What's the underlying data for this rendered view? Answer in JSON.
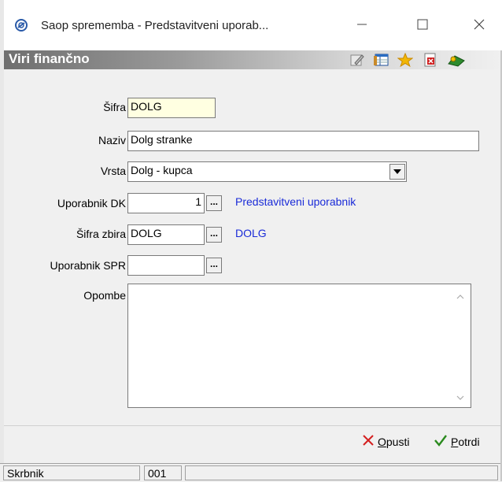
{
  "window": {
    "title": "Saop sprememba - Predstavitveni uporab..."
  },
  "header": {
    "title": "Viri finančno",
    "toolbar_icons": [
      "edit-icon",
      "table-icon",
      "star-icon",
      "delete-icon",
      "exit-icon"
    ]
  },
  "form": {
    "sifra": {
      "label": "Šifra",
      "value": "DOLG"
    },
    "naziv": {
      "label": "Naziv",
      "value": "Dolg stranke"
    },
    "vrsta": {
      "label": "Vrsta",
      "value": "Dolg - kupca"
    },
    "uporabnik_dk": {
      "label": "Uporabnik DK",
      "value": "1",
      "link": "Predstavitveni uporabnik",
      "dots": "..."
    },
    "sifra_zbira": {
      "label": "Šifra zbira",
      "value": "DOLG",
      "link": "DOLG",
      "dots": "..."
    },
    "uporabnik_spr": {
      "label": "Uporabnik SPR",
      "value": "",
      "dots": "..."
    },
    "opombe": {
      "label": "Opombe",
      "value": ""
    }
  },
  "actions": {
    "cancel": {
      "prefix": "",
      "accel": "O",
      "rest": "pusti"
    },
    "confirm": {
      "prefix": "",
      "accel": "P",
      "rest": "otrdi"
    }
  },
  "status": {
    "user": "Skrbnik",
    "code": "001",
    "extra": ""
  },
  "colors": {
    "link": "#1a2bd8",
    "sifra_bg": "#ffffe1",
    "cancel_x": "#d42020",
    "confirm_check": "#2a8a1e"
  }
}
